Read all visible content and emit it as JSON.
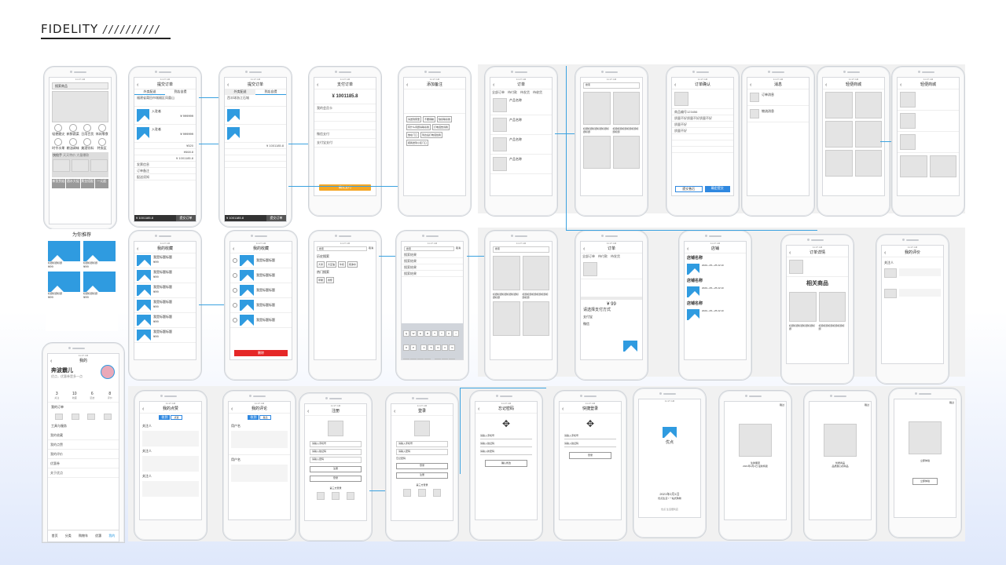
{
  "header": {
    "title": "FIDELITY",
    "slashes": "//////////"
  },
  "status": {
    "carrier": "Applelum",
    "time": "11:27 AM"
  },
  "screens": {
    "home": {
      "search": "搜索商品",
      "cats": [
        "轻便磨尖",
        "新鲜蔬菜",
        "日用百货",
        "休闲零食",
        "时令水果",
        "粮油调味",
        "美酒饮料",
        "特卖区"
      ],
      "quick": "快抢手",
      "quick_sub": "天天特价 大量爆款",
      "promos": [
        "新货到店",
        "酒水大促",
        "黄金搭配",
        "一元起"
      ],
      "section": "为你推荐",
      "price": "¥99"
    },
    "me": {
      "nav": "我的",
      "name": "奔波霸儿",
      "sub": "优点，优惠券是多一点",
      "stats": [
        {
          "v": "3",
          "l": "关注"
        },
        {
          "v": "10",
          "l": "收藏"
        },
        {
          "v": "6",
          "l": "足迹"
        },
        {
          "v": "8",
          "l": "评价"
        }
      ],
      "orders_label": "我的订单",
      "tools_label": "工具与服务",
      "menu": [
        "我的收藏",
        "我的点赞",
        "我的评价",
        "优惠券",
        "关于优点"
      ],
      "tabs": [
        "首页",
        "分类",
        "购物车",
        "优惠",
        "我的"
      ]
    },
    "submit_order": {
      "nav": "提交订单",
      "tabs": [
        "外卖配送",
        "到店自提"
      ],
      "addr": "福建省莆田市城厢区凤凰山",
      "product": "入驻者",
      "price": "¥ 999999",
      "total": "¥ 1001185.8",
      "ship": "¥520",
      "discount": "¥668.8",
      "invoice": "发票信息",
      "note": "订单备注",
      "contact": "配送须知",
      "bottom_total": "¥ 1001185.8",
      "submit": "提交订单"
    },
    "submit_order2": {
      "nav": "提交订单",
      "tabs": [
        "外卖配送",
        "到店自提"
      ],
      "addr": "西半球浙江石城",
      "total": "¥ 1001185.8",
      "bottom_total": "¥ 1001185.8",
      "submit": "提交订单"
    },
    "pay": {
      "nav": "支付订单",
      "amount": "¥ 1001185.8",
      "methods": [
        "我的会员卡",
        "微信支付",
        "支付宝支付"
      ],
      "btn": "确认支付"
    },
    "note": {
      "nav": "添加备注",
      "tags": [
        "请送到家里",
        "不要辣椒",
        "缺货联系我",
        "有什么问题请联系我",
        "打电话告诉我",
        "放在门口",
        "到达后打电话给我",
        "把我送到小区门口"
      ]
    },
    "orders": {
      "nav": "订单",
      "tabs": [
        "全部订单",
        "待付款",
        "待发货",
        "待收货",
        "待评价"
      ],
      "product": "产品名称",
      "price": "¥99"
    },
    "search_res": {
      "placeholder": "搜索",
      "title_text": "标题标题标题标题标题标题标题",
      "price": "¥99"
    },
    "confirm": {
      "nav": "订单确认",
      "items": [
        "商品编号123456",
        "质量不好质量不好质量不好",
        "质量不好",
        "质量不好"
      ],
      "btns": [
        "提交售后",
        "确定提交"
      ]
    },
    "message": {
      "nav": "消息",
      "items": [
        "订单消息",
        "物流消息"
      ]
    },
    "cart": {
      "nav": "轻便商城",
      "price": "¥99"
    },
    "cart2": {
      "nav": "轻便商城"
    },
    "fav": {
      "nav": "我的收藏",
      "item": "我是标题标题",
      "price": "¥99",
      "edit": "编辑"
    },
    "fav2": {
      "nav": "我的收藏",
      "done": "完成",
      "item": "我是标题标题",
      "price": "¥99",
      "del": "删除"
    },
    "search": {
      "placeholder": "搜索",
      "cancel": "取消",
      "history": "历史搜索",
      "hot": "热门搜索",
      "tags": [
        "大米",
        "大豆油",
        "牛奶",
        "纯净水",
        "苹果",
        "香蕉"
      ]
    },
    "search2": {
      "placeholder": "搜索",
      "cancel": "取消",
      "rows": [
        "搜索结果",
        "搜索结果",
        "搜索结果",
        "搜索结果"
      ]
    },
    "goods": {
      "placeholder": "搜索",
      "text": "标题标题标题标题标题标题标题",
      "price": "¥99"
    },
    "order_pay": {
      "nav": "订单",
      "tabs": [
        "全部订单",
        "待付款",
        "待发货"
      ],
      "pay_title": "请选择支付方式",
      "amount": "¥ 99",
      "methods": [
        "支付宝",
        "微信"
      ]
    },
    "store": {
      "nav": "店铺",
      "names": [
        "店铺名称",
        "店铺名称",
        "店铺名称"
      ],
      "time": "2020—05—25 22:10",
      "btn": "确认收货"
    },
    "related": {
      "nav": "订单详情",
      "title": "相关商品",
      "text": "标题标题标题标题标题标题"
    },
    "eval": {
      "nav": "我的评价",
      "user": "关注人"
    },
    "likes": {
      "nav": "我的点赞",
      "tabs": [
        "收到",
        "点赞"
      ],
      "user": "关注人"
    },
    "comments": {
      "nav": "我的评论",
      "tabs": [
        "收到",
        "发出"
      ],
      "user": "用户名"
    },
    "register": {
      "nav": "注册",
      "fields": [
        "请输入手机号",
        "请输入验证码",
        "请输入密码"
      ],
      "btns": [
        "注册",
        "登录"
      ],
      "third": "第三方登录"
    },
    "login": {
      "nav": "登录",
      "fields": [
        "请输入手机号",
        "请输入密码"
      ],
      "forgot": "忘记密码",
      "btns": [
        "登录",
        "注册"
      ],
      "third": "第三方登录"
    },
    "forget": {
      "nav": "忘记密码",
      "fields": [
        "请输入手机号",
        "请输入验证码",
        "请输入新密码"
      ],
      "btn": "确认修改"
    },
    "quick_login": {
      "nav": "快捷登录",
      "fields": [
        "请输入手机号",
        "请输入验证码"
      ],
      "btn": "登录"
    },
    "splash": {
      "name": "优点",
      "date": "2021年2月1日",
      "sub": "优点生活 / 一站式购物",
      "foot": "优点 生活便利店"
    },
    "guide": [
      {
        "skip": "跳过",
        "a": "生鲜果蔬",
        "b": "2021年2月1日 最新特卖"
      },
      {
        "skip": "跳过",
        "a": "优质商品",
        "b": "品质放心的商品"
      },
      {
        "skip": "跳过",
        "a": "立即体验",
        "btn": "立即体验"
      }
    ]
  },
  "colors": {
    "accent": "#2f9be0",
    "orange": "#f5a623",
    "red": "#e52727",
    "connector": "#3ba2e0"
  }
}
